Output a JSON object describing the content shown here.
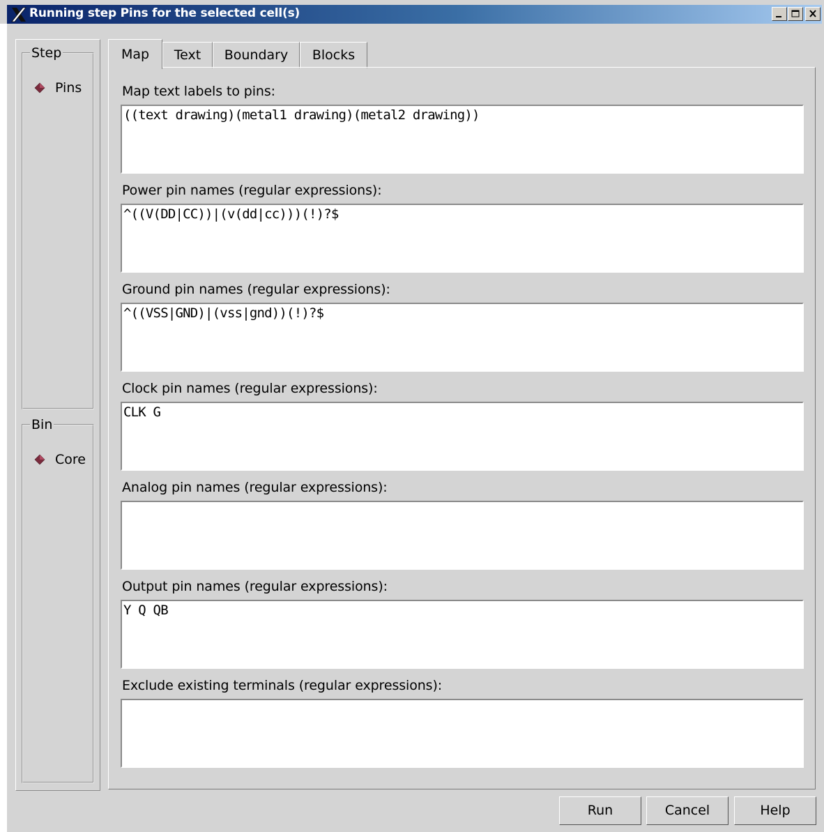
{
  "window": {
    "title": "Running step Pins for the selected cell(s)",
    "icon": "x-logo-icon",
    "controls": [
      "minimize-icon",
      "maximize-icon",
      "close-icon"
    ]
  },
  "step_group": {
    "label": "Step",
    "option": "Pins"
  },
  "bin_group": {
    "label": "Bin",
    "option": "Core"
  },
  "tabs": [
    {
      "label": "Map",
      "active": true
    },
    {
      "label": "Text",
      "active": false
    },
    {
      "label": "Boundary",
      "active": false
    },
    {
      "label": "Blocks",
      "active": false
    }
  ],
  "fields": [
    {
      "label": "Map text labels to pins:",
      "value": "((text drawing)(metal1 drawing)(metal2 drawing))"
    },
    {
      "label": "Power pin names (regular expressions):",
      "value": "^((V(DD|CC))|(v(dd|cc)))(!)?$"
    },
    {
      "label": "Ground pin names (regular expressions):",
      "value": "^((VSS|GND)|(vss|gnd))(!)?$"
    },
    {
      "label": "Clock pin names (regular expressions):",
      "value": "CLK G"
    },
    {
      "label": "Analog pin names (regular expressions):",
      "value": ""
    },
    {
      "label": "Output pin names (regular expressions):",
      "value": "Y Q QB"
    },
    {
      "label": "Exclude existing terminals (regular expressions):",
      "value": ""
    }
  ],
  "buttons": {
    "run": "Run",
    "cancel": "Cancel",
    "help": "Help"
  },
  "colors": {
    "radio_selected": "#7a2a3c",
    "titlebar": "#0a246a"
  }
}
